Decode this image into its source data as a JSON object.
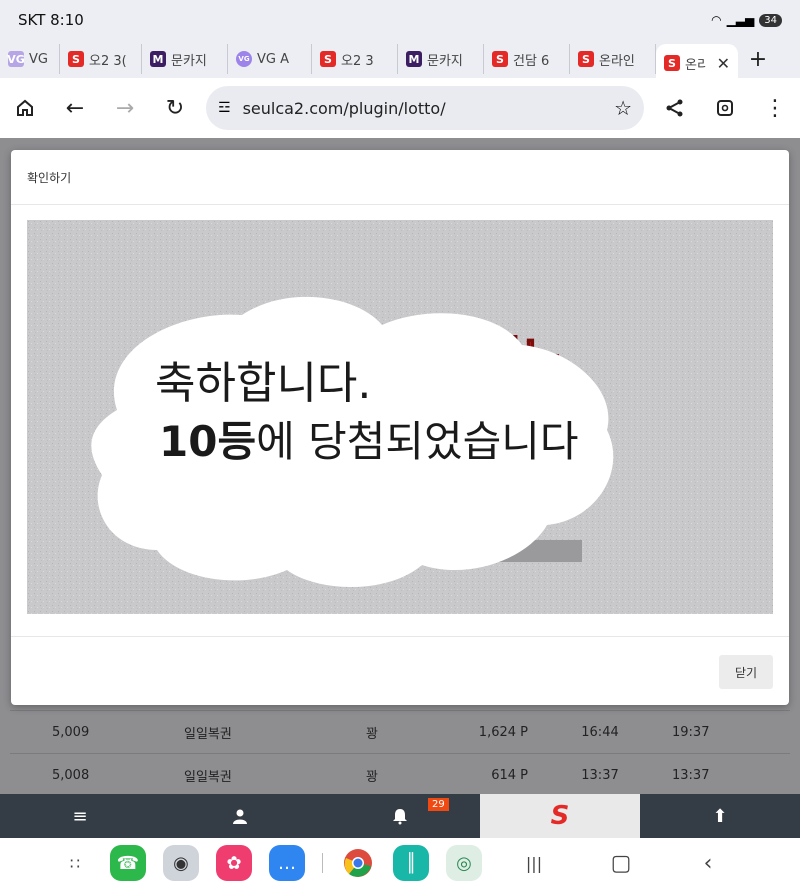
{
  "status": {
    "time": "SKT 8:10",
    "battery": "34"
  },
  "tabs": [
    {
      "title": "VG Ar",
      "fav": "VG",
      "color": "#b7a6e6"
    },
    {
      "title": "오2 3(",
      "fav": "S",
      "color": "#e32a27"
    },
    {
      "title": "문카지",
      "fav": "M",
      "color": "#3c1f63"
    },
    {
      "title": "VG A",
      "fav": "VG",
      "color": "#9c84ea"
    },
    {
      "title": "오2 3",
      "fav": "S",
      "color": "#e32a27"
    },
    {
      "title": "문카지",
      "fav": "M",
      "color": "#3c1f63"
    },
    {
      "title": "건담 6",
      "fav": "S",
      "color": "#e32a27"
    },
    {
      "title": "온라인",
      "fav": "S",
      "color": "#e32a27"
    },
    {
      "title": "온리",
      "fav": "S",
      "color": "#e32a27"
    }
  ],
  "toolbar": {
    "url": "seulca2.com/plugin/lotto/"
  },
  "modal": {
    "title": "확인하기",
    "brand_text": "카지노",
    "line1": "축하합니다.",
    "line2_num": "10",
    "line2_rank": "등",
    "line2_rest": "에 당첨되었습니다",
    "close_label": "닫기"
  },
  "rows": [
    {
      "id": "5,009",
      "name": "일일복권",
      "result": "꽝",
      "points": "1,624 P",
      "t1": "16:44",
      "t2": "19:37"
    },
    {
      "id": "5,008",
      "name": "일일복권",
      "result": "꽝",
      "points": "614 P",
      "t1": "13:37",
      "t2": "13:37"
    }
  ],
  "bottom_nav": {
    "badge_count": "29"
  },
  "colors": {
    "brand_red": "#e32a27",
    "nav_dark": "#343c45",
    "badge": "#f04a12"
  }
}
